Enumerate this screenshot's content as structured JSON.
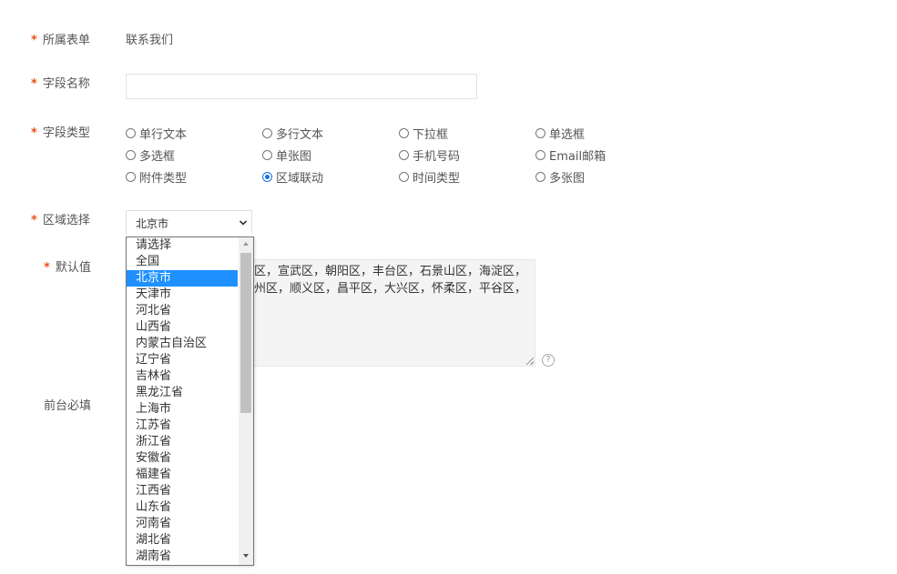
{
  "form": {
    "belong_form": {
      "label": "所属表单",
      "value": "联系我们"
    },
    "field_name": {
      "label": "字段名称",
      "value": "",
      "placeholder": ""
    },
    "field_type": {
      "label": "字段类型",
      "options": [
        {
          "label": "单行文本",
          "checked": false
        },
        {
          "label": "多行文本",
          "checked": false
        },
        {
          "label": "下拉框",
          "checked": false
        },
        {
          "label": "单选框",
          "checked": false
        },
        {
          "label": "多选框",
          "checked": false
        },
        {
          "label": "单张图",
          "checked": false
        },
        {
          "label": "手机号码",
          "checked": false
        },
        {
          "label": "Email邮箱",
          "checked": false
        },
        {
          "label": "附件类型",
          "checked": false
        },
        {
          "label": "区域联动",
          "checked": true
        },
        {
          "label": "时间类型",
          "checked": false
        },
        {
          "label": "多张图",
          "checked": false
        }
      ]
    },
    "region": {
      "label": "区域选择",
      "selected": "北京市",
      "options": [
        "请选择",
        "全国",
        "北京市",
        "天津市",
        "河北省",
        "山西省",
        "内蒙古自治区",
        "辽宁省",
        "吉林省",
        "黑龙江省",
        "上海市",
        "江苏省",
        "浙江省",
        "安徽省",
        "福建省",
        "江西省",
        "山东省",
        "河南省",
        "湖北省",
        "湖南省"
      ]
    },
    "default_value": {
      "label": "默认值",
      "line1": "区，宣武区，朝阳区，丰台区，石景山区，海淀区，",
      "line2": "州区，顺义区，昌平区，大兴区，怀柔区，平谷区，",
      "help_icon": "?"
    },
    "frontend_required": {
      "label": "前台必填"
    },
    "required_mark": "*"
  },
  "colors": {
    "required": "#e8521a",
    "selected_option_bg": "#1e90ff",
    "radio_checked": "#1a73e8"
  }
}
